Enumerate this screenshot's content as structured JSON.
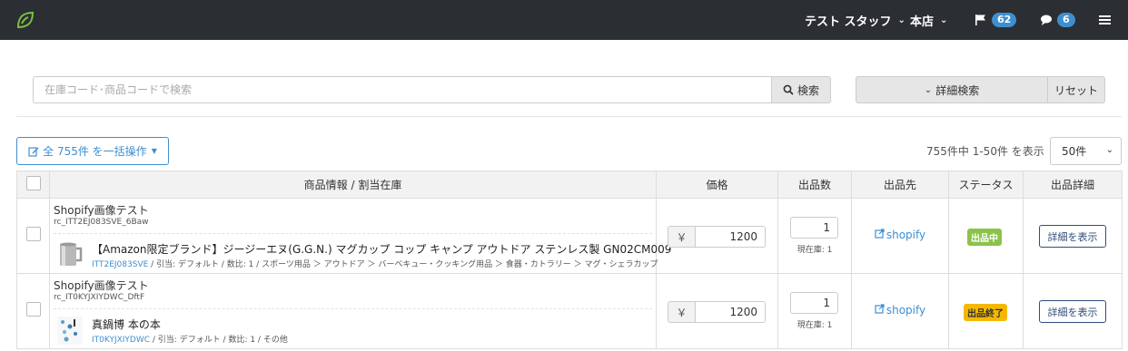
{
  "nav": {
    "staff_label": "テスト スタッフ",
    "store_label": "本店",
    "flag_count": "62",
    "message_count": "6",
    "icons": {
      "logo": "leaf-logo",
      "flag": "flag-icon",
      "chat": "chat-icon",
      "menu": "hamburger-icon"
    }
  },
  "search": {
    "placeholder": "在庫コード･商品コードで検索",
    "value": "",
    "button_label": "検索",
    "detail_label": "詳細検索",
    "reset_label": "リセット"
  },
  "bulk": {
    "label": "全 755件 を一括操作"
  },
  "paging": {
    "summary": "755件中 1-50件 を表示",
    "per_page": "50件"
  },
  "table": {
    "headers": [
      "商品情報 / 割当在庫",
      "価格",
      "出品数",
      "出品先",
      "ステータス",
      "出品詳細"
    ],
    "rows": [
      {
        "title": "Shopify画像テスト",
        "code": "rc_ITT2EJ083SVE_6Baw",
        "name": "【Amazon限定ブランド】ジージーエヌ(G.G.N.) マグカップ コップ キャンプ アウトドア ステンレス製 GN02CM009",
        "sku": "ITT2EJ083SVE",
        "meta": " / 引当: デフォルト / 数比: 1 / スポーツ用品 ＞ アウトドア ＞ バーベキュー・クッキング用品 ＞ 食器・カトラリー ＞ マグ・シェラカップ",
        "currency": "￥",
        "price": "1200",
        "qty": "1",
        "stock": "現在庫: 1",
        "channel": "shopify",
        "status": "出品中",
        "detail_label": "詳細を表示"
      },
      {
        "title": "Shopify画像テスト",
        "code": "rc_IT0KYJXIYDWC_DftF",
        "name": "真鍋博 本の本",
        "sku": "IT0KYJXIYDWC",
        "meta": " / 引当: デフォルト / 数比: 1 / その他",
        "currency": "￥",
        "price": "1200",
        "qty": "1",
        "stock": "現在庫: 1",
        "channel": "shopify",
        "status": "出品終了",
        "detail_label": "詳細を表示"
      }
    ]
  },
  "colors": {
    "nav_bg": "#2b2f33",
    "accent": "#3f8fd0",
    "status_active": "#8bc34a",
    "status_ended": "#f5b800"
  }
}
